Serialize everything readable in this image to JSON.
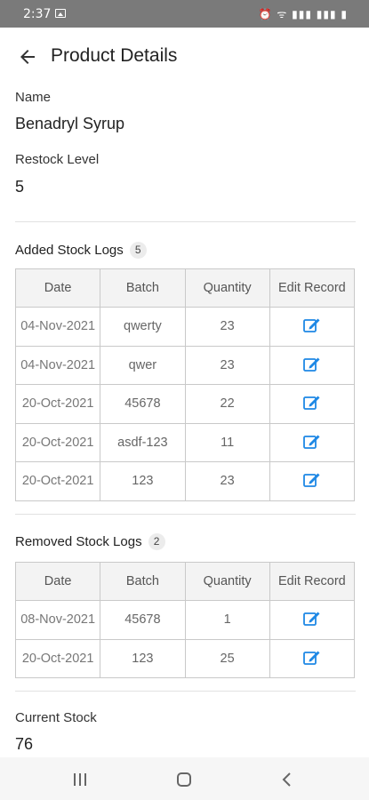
{
  "status_bar": {
    "time": "2:37",
    "right_indicators": "⏰ ᯤ ▮▮▮ ▮▮▮ ▮"
  },
  "app_bar": {
    "title": "Product Details"
  },
  "fields": {
    "name_label": "Name",
    "name_value": "Benadryl Syrup",
    "restock_label": "Restock Level",
    "restock_value": "5",
    "current_stock_label": "Current Stock",
    "current_stock_value": "76"
  },
  "added_logs": {
    "title": "Added Stock Logs",
    "count": "5",
    "headers": [
      "Date",
      "Batch",
      "Quantity",
      "Edit Record"
    ],
    "rows": [
      {
        "date": "04-Nov-2021",
        "batch": "qwerty",
        "quantity": "23"
      },
      {
        "date": "04-Nov-2021",
        "batch": "qwer",
        "quantity": "23"
      },
      {
        "date": "20-Oct-2021",
        "batch": "45678",
        "quantity": "22"
      },
      {
        "date": "20-Oct-2021",
        "batch": "asdf-123",
        "quantity": "11"
      },
      {
        "date": "20-Oct-2021",
        "batch": "123",
        "quantity": "23"
      }
    ]
  },
  "removed_logs": {
    "title": "Removed Stock Logs",
    "count": "2",
    "headers": [
      "Date",
      "Batch",
      "Quantity",
      "Edit Record"
    ],
    "rows": [
      {
        "date": "08-Nov-2021",
        "batch": "45678",
        "quantity": "1"
      },
      {
        "date": "20-Oct-2021",
        "batch": "123",
        "quantity": "25"
      }
    ]
  },
  "icons": {
    "back": "arrow-left-icon",
    "edit": "edit-icon",
    "nav_recents": "recents-icon",
    "nav_home": "home-icon",
    "nav_back": "chevron-left-icon"
  },
  "colors": {
    "accent": "#1e88e5",
    "status_bar": "#7a7a7a",
    "table_header": "#f3f3f3"
  }
}
